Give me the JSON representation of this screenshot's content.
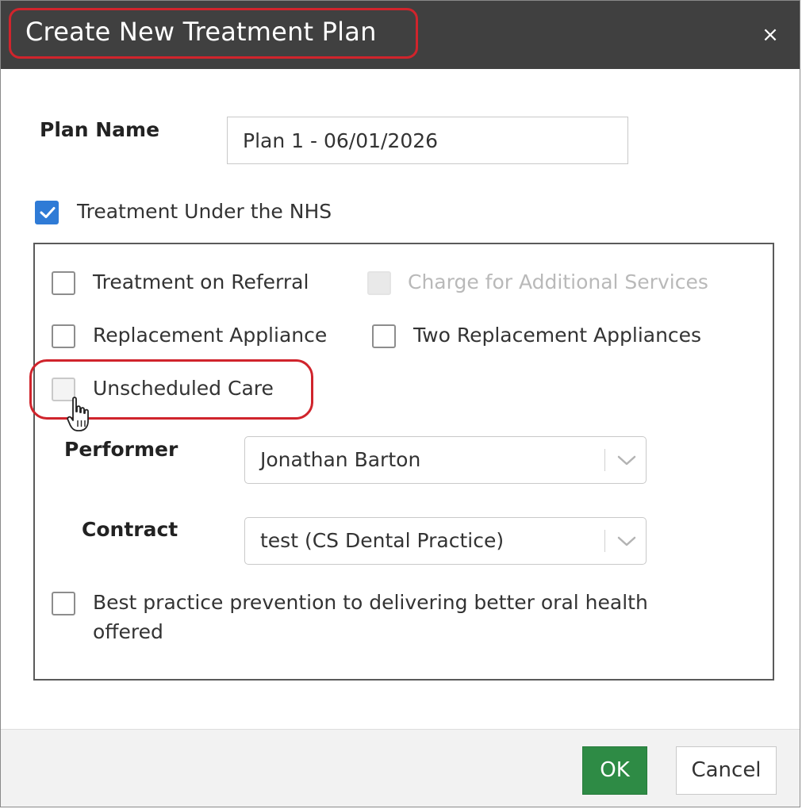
{
  "dialog": {
    "title": "Create New Treatment Plan",
    "close_label": "×"
  },
  "form": {
    "plan_name_label": "Plan Name",
    "plan_name_value": "Plan 1 - 06/01/2026",
    "nhs_checkbox": {
      "label": "Treatment Under the NHS",
      "checked": true
    },
    "options": {
      "treatment_on_referral": {
        "label": "Treatment on Referral",
        "checked": false
      },
      "charge_additional_services": {
        "label": "Charge for Additional Services",
        "checked": false,
        "disabled": true
      },
      "replacement_appliance": {
        "label": "Replacement Appliance",
        "checked": false
      },
      "two_replacement_appliances": {
        "label": "Two Replacement Appliances",
        "checked": false
      },
      "unscheduled_care": {
        "label": "Unscheduled Care",
        "checked": false
      },
      "best_practice": {
        "label_line1": "Best practice prevention to delivering better oral health",
        "label_line2": "offered",
        "checked": false
      }
    },
    "performer": {
      "label": "Performer",
      "value": "Jonathan Barton"
    },
    "contract": {
      "label": "Contract",
      "value": "test (CS Dental Practice)"
    }
  },
  "footer": {
    "ok_label": "OK",
    "cancel_label": "Cancel"
  },
  "colors": {
    "titlebar": "#404040",
    "checkbox_checked": "#2f7bd6",
    "ok_button": "#2e8b45",
    "highlight": "#d0242c"
  },
  "icons": {
    "close": "close-icon",
    "check": "check-icon",
    "chevron": "chevron-down-icon",
    "cursor": "hand-pointer-icon"
  }
}
